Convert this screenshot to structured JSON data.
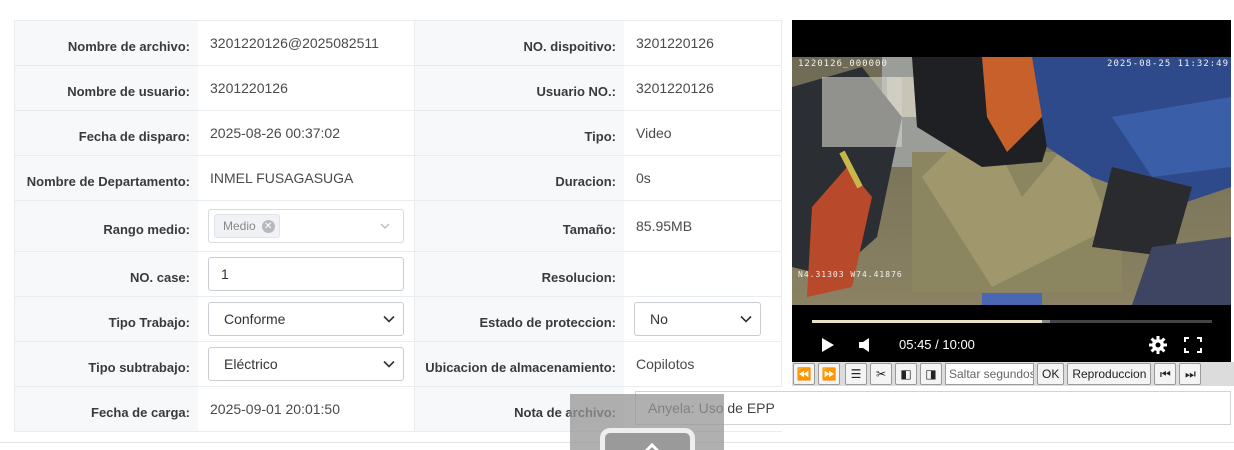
{
  "fields": {
    "file_name": {
      "label": "Nombre de archivo:",
      "value": "3201220126@2025082511"
    },
    "device_no": {
      "label": "NO. dispoitivo:",
      "value": "3201220126"
    },
    "user_name": {
      "label": "Nombre de usuario:",
      "value": "3201220126"
    },
    "user_no": {
      "label": "Usuario NO.:",
      "value": "3201220126"
    },
    "trigger_date": {
      "label": "Fecha de disparo:",
      "value": "2025-08-26 00:37:02"
    },
    "type": {
      "label": "Tipo:",
      "value": "Video"
    },
    "department": {
      "label": "Nombre de Departamento:",
      "value": "INMEL FUSAGASUGA"
    },
    "duration": {
      "label": "Duracion:",
      "value": "0s"
    },
    "range": {
      "label": "Rango medio:",
      "tag": "Medio"
    },
    "size": {
      "label": "Tamaño:",
      "value": "85.95MB"
    },
    "case_no": {
      "label": "NO. case:",
      "value": "1"
    },
    "resolution": {
      "label": "Resolucion:",
      "value": ""
    },
    "work_type": {
      "label": "Tipo Trabajo:",
      "value": "Conforme"
    },
    "protection": {
      "label": "Estado de proteccion:",
      "value": "No"
    },
    "work_subtype": {
      "label": "Tipo subtrabajo:",
      "value": "Eléctrico"
    },
    "storage": {
      "label": "Ubicacion de almacenamiento:",
      "value": "Copilotos"
    },
    "upload_date": {
      "label": "Fecha de carga:",
      "value": "2025-09-01 20:01:50"
    },
    "note": {
      "label": "Nota de archivo:",
      "value": "Anyela: Uso de EPP"
    }
  },
  "video": {
    "osd_left": "1220126_000000",
    "osd_right": "2025-08-25 11:32:49",
    "osd_gps": "N4.31303 W74.41876",
    "time": "05:45 / 10:00",
    "progress_fraction": 0.575
  },
  "toolbar": {
    "skip_placeholder": "Saltar segundos",
    "ok_label": "OK",
    "play_label": "Reproduccion"
  },
  "colors": {
    "label_bg": "#f7f8fa",
    "border": "#e8ebef",
    "video_bg": "#000000"
  }
}
